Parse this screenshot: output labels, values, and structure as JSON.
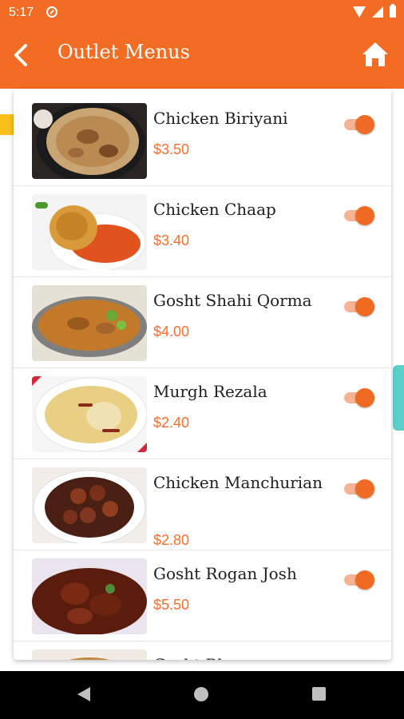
{
  "status_bar": {
    "time": "5:17"
  },
  "app_bar": {
    "title": "Outlet Menus"
  },
  "menu": [
    {
      "name": "Chicken Biriyani",
      "price": "$3.50",
      "enabled": true
    },
    {
      "name": "Chicken Chaap",
      "price": "$3.40",
      "enabled": true
    },
    {
      "name": "Gosht Shahi Qorma",
      "price": "$4.00",
      "enabled": true
    },
    {
      "name": "Murgh Rezala",
      "price": "$2.40",
      "enabled": true
    },
    {
      "name": "Chicken Manchurian",
      "price": "$2.80",
      "enabled": true
    },
    {
      "name": "Gosht Rogan Josh",
      "price": "$5.50",
      "enabled": true
    },
    {
      "name": "Gosht Bhunaa",
      "price": "",
      "enabled": true
    }
  ],
  "colors": {
    "accent": "#f26c23",
    "price": "#ff6d2d",
    "toggle_on": "#ef6a22"
  }
}
